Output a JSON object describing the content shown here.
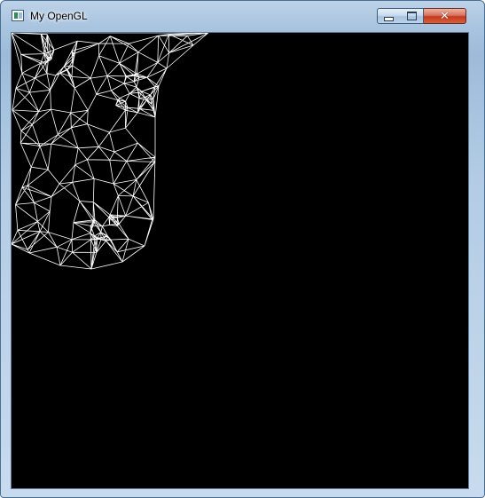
{
  "window": {
    "title": "My OpenGL",
    "icon": "app-window-icon",
    "controls": {
      "minimize_icon": "minimize-icon",
      "maximize_icon": "maximize-icon",
      "close_glyph": "✕"
    }
  },
  "viewport": {
    "background_color": "#000000",
    "wire_color": "#ffffff",
    "render_mode": "wireframe"
  }
}
